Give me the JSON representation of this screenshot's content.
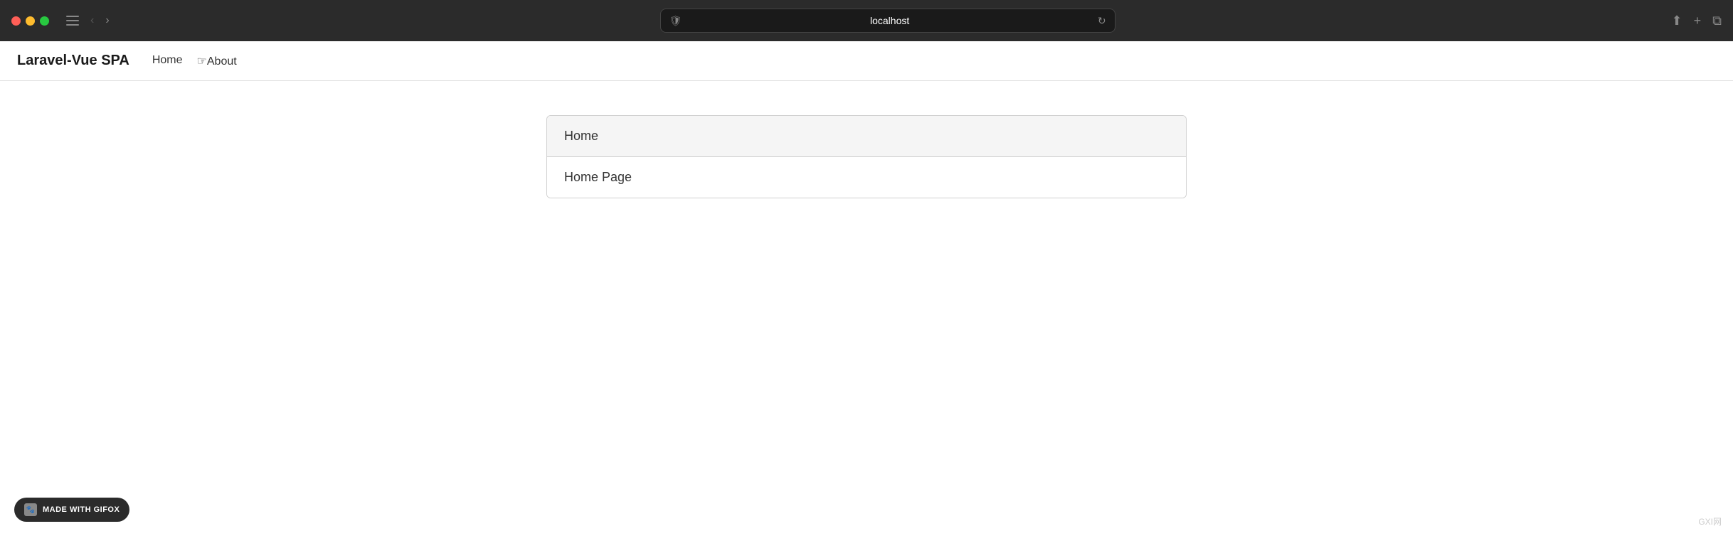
{
  "browser": {
    "address": "localhost",
    "reload_label": "↻",
    "back_label": "‹",
    "forward_label": "›"
  },
  "app": {
    "title": "Laravel-Vue SPA",
    "nav": {
      "home_label": "Home",
      "about_label": "About"
    }
  },
  "card": {
    "header": "Home",
    "body": "Home Page"
  },
  "footer": {
    "badge_label": "MADE WITH GIFOX"
  },
  "watermark": {
    "text": "GXI网"
  }
}
